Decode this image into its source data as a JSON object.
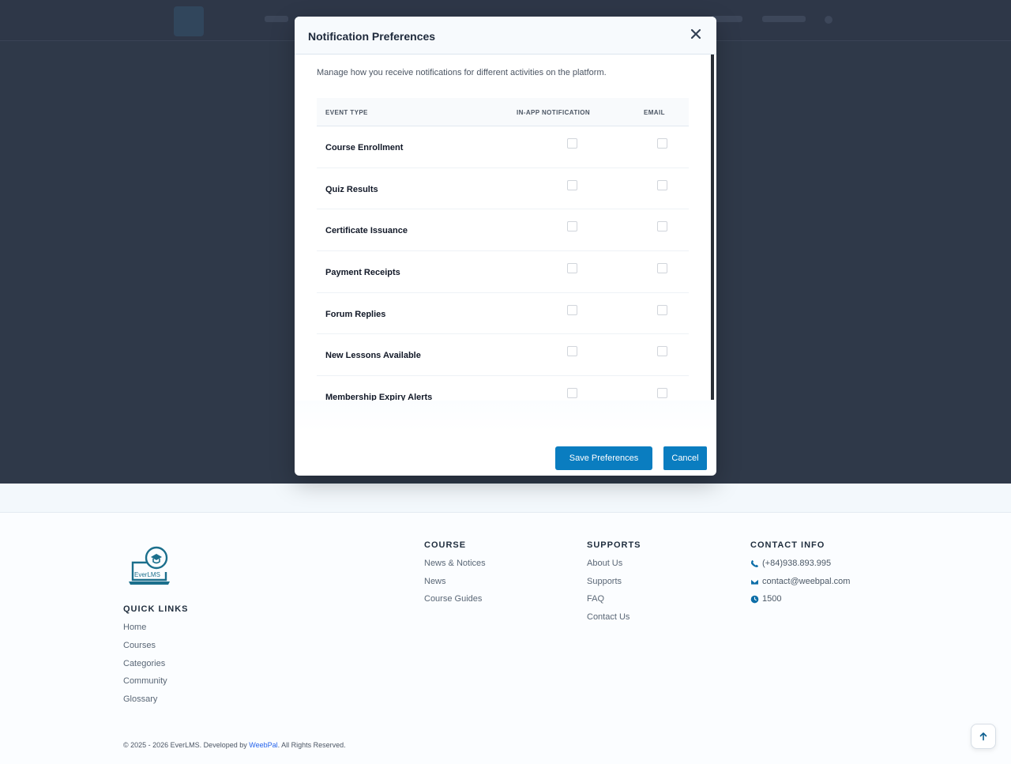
{
  "modal": {
    "title": "Notification Preferences",
    "description": "Manage how you receive notifications for different activities on the platform.",
    "columns": {
      "event_type": "EVENT TYPE",
      "in_app": "IN-APP NOTIFICATION",
      "email": "EMAIL"
    },
    "rows": [
      {
        "label": "Course Enrollment",
        "in_app": false,
        "email": false
      },
      {
        "label": "Quiz Results",
        "in_app": false,
        "email": false
      },
      {
        "label": "Certificate Issuance",
        "in_app": false,
        "email": false
      },
      {
        "label": "Payment Receipts",
        "in_app": false,
        "email": false
      },
      {
        "label": "Forum Replies",
        "in_app": false,
        "email": false
      },
      {
        "label": "New Lessons Available",
        "in_app": false,
        "email": false
      },
      {
        "label": "Membership Expiry Alerts",
        "in_app": false,
        "email": false
      }
    ],
    "save_label": "Save Preferences",
    "cancel_label": "Cancel"
  },
  "footer": {
    "logo_text": "EverLMS",
    "quick_links": {
      "heading": "QUICK LINKS",
      "items": [
        "Home",
        "Courses",
        "Categories",
        "Community",
        "Glossary"
      ]
    },
    "course": {
      "heading": "COURSE",
      "items": [
        "News & Notices",
        "News",
        "Course Guides"
      ]
    },
    "supports": {
      "heading": "SUPPORTS",
      "items": [
        "About Us",
        "Supports",
        "FAQ",
        "Contact Us"
      ]
    },
    "contact": {
      "heading": "CONTACT INFO",
      "phone": "(+84)938.893.995",
      "email": "contact@weebpal.com",
      "hours": "1500"
    },
    "copyright_prefix": "© 2025 - 2026 EverLMS. Developed by ",
    "copyright_brand": "WeebPal",
    "copyright_suffix": ". All Rights Reserved."
  },
  "colors": {
    "accent": "#0a7dc0",
    "overlay": "#2f3949"
  }
}
